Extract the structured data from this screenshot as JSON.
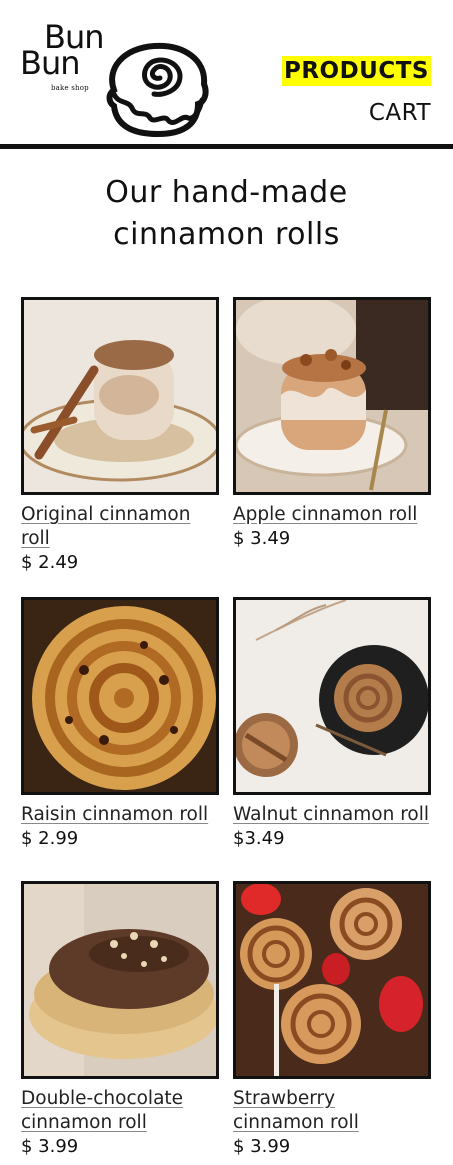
{
  "brand": {
    "line1": "Bun",
    "line2": "Bun",
    "subtitle": "bake shop"
  },
  "nav": {
    "products": "PRODUCTS",
    "cart": "CART",
    "active_color": "#ffff00"
  },
  "hero": {
    "line1": "Our hand-made",
    "line2": "cinnamon rolls"
  },
  "products": [
    {
      "name": "Original cinnamon roll",
      "price": "$ 2.49",
      "image": "original-roll-image"
    },
    {
      "name": "Apple cinnamon roll",
      "price": "$ 3.49",
      "image": "apple-roll-image"
    },
    {
      "name": "Raisin cinnamon roll",
      "price": "$ 2.99",
      "image": "raisin-roll-image"
    },
    {
      "name": "Walnut cinnamon roll",
      "price": "$3.49",
      "image": "walnut-roll-image"
    },
    {
      "name": "Double-chocolate cinnamon roll",
      "price": "$ 3.99",
      "image": "double-chocolate-roll-image"
    },
    {
      "name": "Strawberry cinnamon roll",
      "price": "$ 3.99",
      "image": "strawberry-roll-image"
    }
  ]
}
